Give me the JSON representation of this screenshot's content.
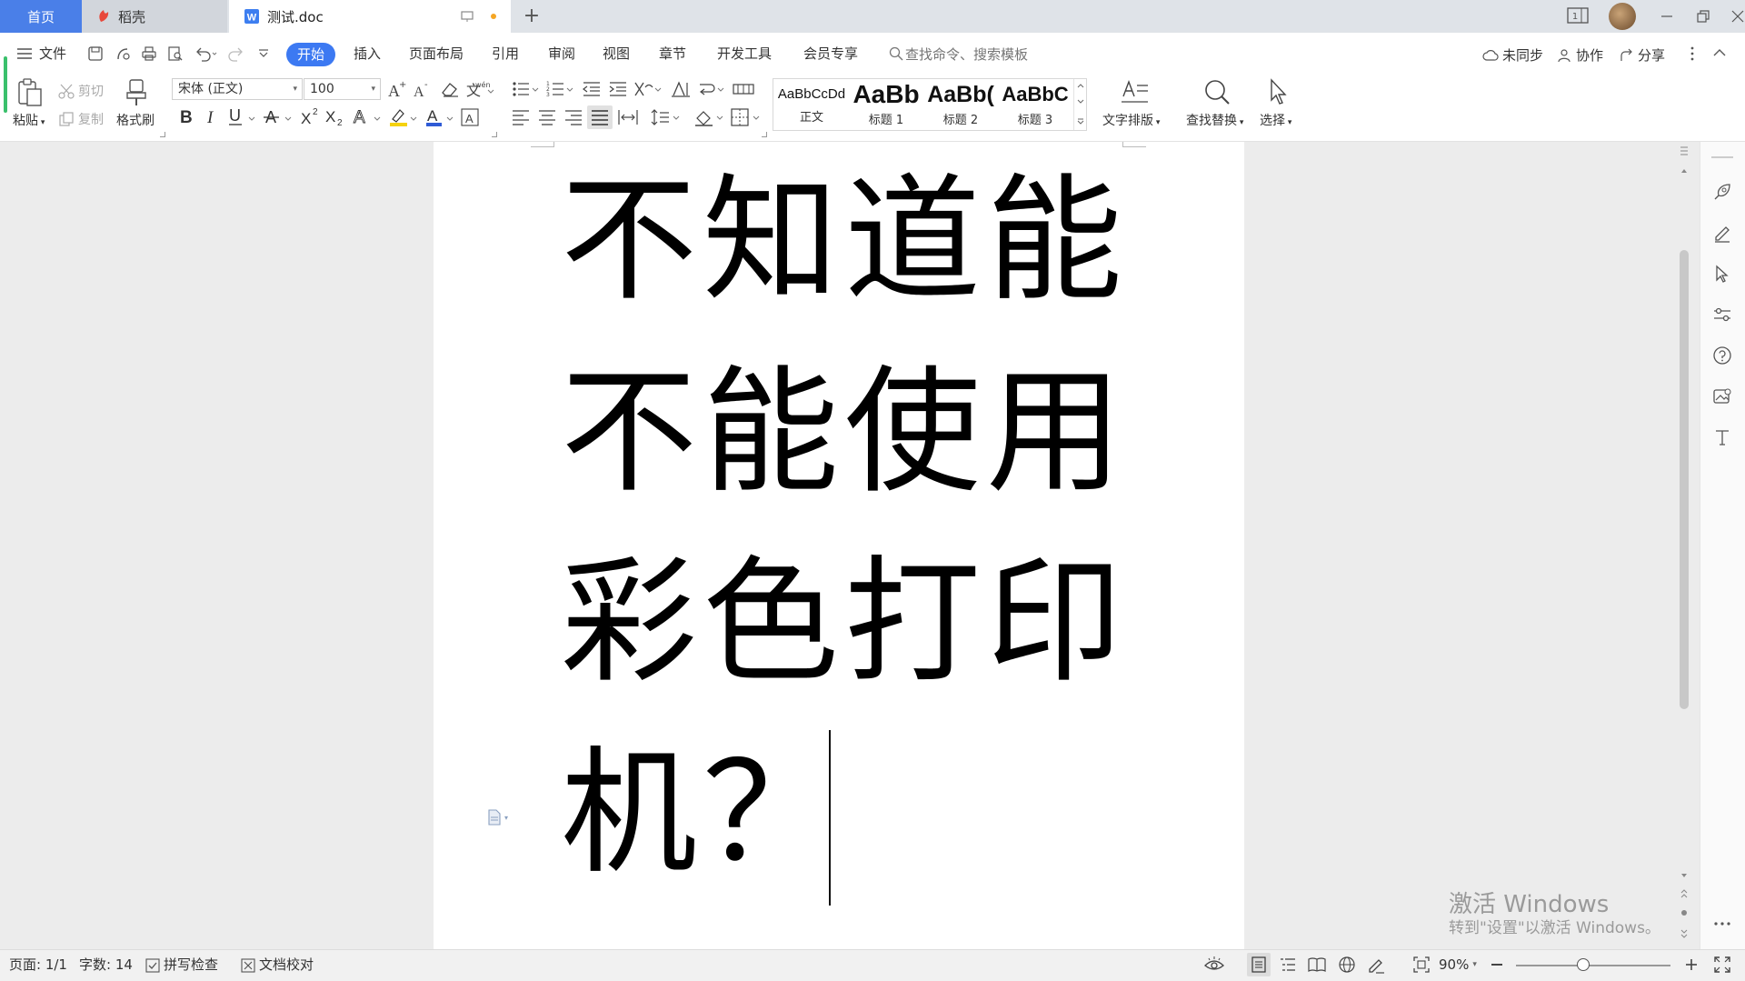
{
  "titlebar": {
    "tabs": [
      {
        "label": "首页"
      },
      {
        "label": "稻壳"
      },
      {
        "label": "测试.doc"
      }
    ],
    "new_tab": "+",
    "window_badge": "1"
  },
  "menubar": {
    "file": "文件",
    "tabs": [
      "开始",
      "插入",
      "页面布局",
      "引用",
      "审阅",
      "视图",
      "章节",
      "开发工具",
      "会员专享"
    ],
    "active_tab": "开始",
    "search_placeholder": "查找命令、搜索模板",
    "sync": "未同步",
    "collab": "协作",
    "share": "分享"
  },
  "ribbon": {
    "paste": "粘贴",
    "cut": "剪切",
    "copy": "复制",
    "format_painter": "格式刷",
    "font_name": "宋体 (正文)",
    "font_size": "100",
    "styles": [
      {
        "preview": "AaBbCcDd",
        "name": "正文"
      },
      {
        "preview": "AaBb",
        "name": "标题 1"
      },
      {
        "preview": "AaBb(",
        "name": "标题 2"
      },
      {
        "preview": "AaBbC",
        "name": "标题 3"
      }
    ],
    "text_layout": "文字排版",
    "find_replace": "查找替换",
    "select": "选择"
  },
  "document": {
    "lines": [
      "不知道能",
      "不能使用",
      "彩色打印",
      "机？"
    ]
  },
  "watermark": {
    "title": "激活 Windows",
    "subtitle": "转到\"设置\"以激活 Windows。"
  },
  "statusbar": {
    "page": "页面: 1/1",
    "word_count": "字数: 14",
    "spell_check": "拼写检查",
    "doc_proof": "文档校对",
    "zoom": "90%"
  },
  "colors": {
    "accent": "#3c79f2",
    "home_tab": "#4a7fe8",
    "highlight_yellow": "#f5d20c",
    "font_color_blue": "#2f5bd6"
  }
}
